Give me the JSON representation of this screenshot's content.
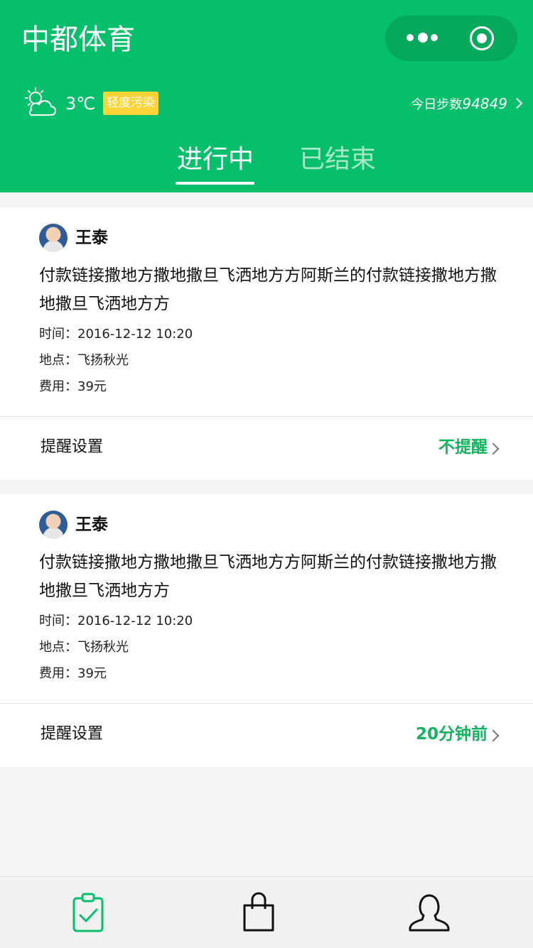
{
  "header": {
    "title": "中都体育",
    "weather": {
      "temperature": "3℃",
      "air_quality": "轻度污染"
    },
    "steps": {
      "label": "今日步数",
      "value": "94849"
    },
    "tabs": [
      {
        "label": "进行中",
        "active": true
      },
      {
        "label": "已结束",
        "active": false
      }
    ]
  },
  "events": [
    {
      "user": "王泰",
      "description": "付款链接撒地方撒地撒旦飞洒地方方阿斯兰的付款链接撒地方撒地撒旦飞洒地方方",
      "time_label": "时间：",
      "time": "2016-12-12 10:20",
      "place_label": "地点：",
      "place": "飞扬秋光",
      "fee_label": "费用：",
      "fee": "39元",
      "remind_label": "提醒设置",
      "remind_value": "不提醒"
    },
    {
      "user": "王泰",
      "description": "付款链接撒地方撒地撒旦飞洒地方方阿斯兰的付款链接撒地方撒地撒旦飞洒地方方",
      "time_label": "时间：",
      "time": "2016-12-12 10:20",
      "place_label": "地点：",
      "place": "飞扬秋光",
      "fee_label": "费用：",
      "fee": "39元",
      "remind_label": "提醒设置",
      "remind_value": "20分钟前"
    }
  ],
  "tabbar": {
    "items": [
      {
        "icon": "clipboard-check-icon",
        "active": true
      },
      {
        "icon": "shopping-bag-icon",
        "active": false
      },
      {
        "icon": "person-icon",
        "active": false
      }
    ]
  },
  "colors": {
    "brand": "#06bf6b",
    "accent_text": "#11b45e",
    "badge": "#fdd436"
  }
}
